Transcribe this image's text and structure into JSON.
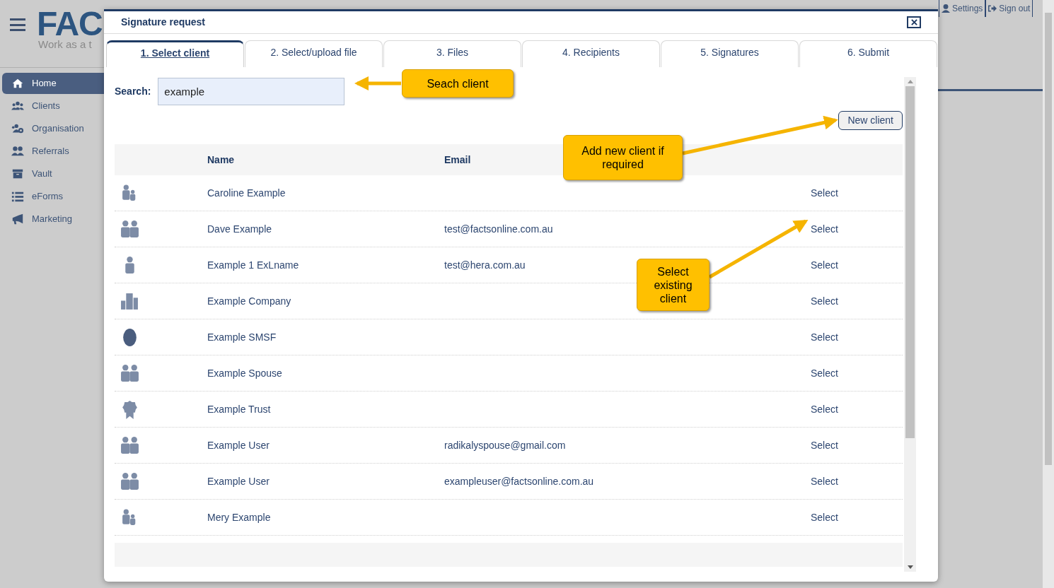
{
  "background": {
    "logo": "FAC",
    "tagline": "Work as a t",
    "top_links": [
      {
        "label": "Settings",
        "kind": "settings"
      },
      {
        "label": "Sign out",
        "kind": "signout"
      }
    ],
    "sidebar": [
      {
        "label": "Home",
        "kind": "home",
        "selected": true
      },
      {
        "label": "Clients",
        "kind": "clients",
        "selected": false
      },
      {
        "label": "Organisation",
        "kind": "org",
        "selected": false
      },
      {
        "label": "Referrals",
        "kind": "referrals",
        "selected": false
      },
      {
        "label": "Vault",
        "kind": "vault",
        "selected": false
      },
      {
        "label": "eForms",
        "kind": "list",
        "selected": false
      },
      {
        "label": "Marketing",
        "kind": "megaphone",
        "selected": false
      }
    ]
  },
  "dialog": {
    "title": "Signature request",
    "tabs": [
      {
        "label": "1. Select client",
        "selected": true
      },
      {
        "label": "2. Select/upload file",
        "selected": false
      },
      {
        "label": "3. Files",
        "selected": false
      },
      {
        "label": "4. Recipients",
        "selected": false
      },
      {
        "label": "5. Signatures",
        "selected": false
      },
      {
        "label": "6. Submit",
        "selected": false
      }
    ],
    "search": {
      "label": "Search:",
      "value": "example"
    },
    "new_client_button": "New client",
    "table": {
      "columns": [
        "Name",
        "Email"
      ],
      "rows": [
        {
          "kind": "family",
          "name": "Caroline Example",
          "action": "Select"
        },
        {
          "kind": "couple",
          "name": "Dave Example",
          "email": "test@factsonline.com.au",
          "action": "Select"
        },
        {
          "kind": "person",
          "name": "Example 1 ExLname",
          "email": "test@hera.com.au",
          "action": "Select"
        },
        {
          "kind": "company",
          "name": "Example Company",
          "action": "Select"
        },
        {
          "kind": "smsf",
          "name": "Example SMSF",
          "action": "Select"
        },
        {
          "kind": "couple",
          "name": "Example Spouse",
          "action": "Select"
        },
        {
          "kind": "trust",
          "name": "Example Trust",
          "action": "Select"
        },
        {
          "kind": "couple",
          "name": "Example User",
          "email": "radikalyspouse@gmail.com",
          "action": "Select"
        },
        {
          "kind": "couple",
          "name": "Example User",
          "email": "exampleuser@factsonline.com.au",
          "action": "Select"
        },
        {
          "kind": "family",
          "name": "Mery Example",
          "action": "Select"
        }
      ]
    }
  },
  "callouts": [
    {
      "text": "Seach client"
    },
    {
      "text": "Add new client if required"
    },
    {
      "text": "Select existing client"
    }
  ]
}
